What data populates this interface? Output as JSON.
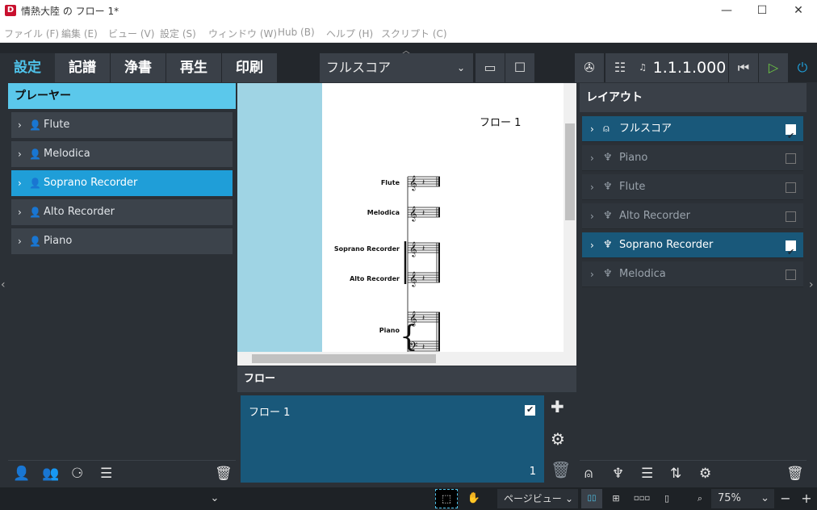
{
  "window": {
    "title": "情熱大陸 の フロー 1*",
    "app_icon": "D",
    "minimize": "—",
    "maximize": "☐",
    "close": "✕"
  },
  "menu": [
    "ファイル (F)",
    "編集 (E)",
    "ビュー (V)",
    "設定 (S)",
    "ウィンドウ (W)",
    "Hub (B)",
    "ヘルプ (H)",
    "スクリプト (C)"
  ],
  "modes": [
    "設定",
    "記譜",
    "浄書",
    "再生",
    "印刷"
  ],
  "active_mode": "設定",
  "toolbar": {
    "layout_select": "フルスコア",
    "position": "1.1.1.000"
  },
  "players_panel": {
    "title": "プレーヤー",
    "players": [
      {
        "name": "Flute",
        "selected": false
      },
      {
        "name": "Melodica",
        "selected": false
      },
      {
        "name": "Soprano Recorder",
        "selected": true
      },
      {
        "name": "Alto Recorder",
        "selected": false
      },
      {
        "name": "Piano",
        "selected": false
      }
    ]
  },
  "score": {
    "title": "フロー 1",
    "staves": [
      "Flute",
      "Melodica",
      "Soprano Recorder",
      "Alto Recorder",
      "Piano"
    ]
  },
  "flow_panel": {
    "title": "フロー",
    "flow_name": "フロー 1",
    "flow_number": "1",
    "checked": true
  },
  "layout_panel": {
    "title": "レイアウト",
    "items": [
      {
        "name": "フルスコア",
        "checked": true,
        "selected": true,
        "icon": "full-score-icon"
      },
      {
        "name": "Piano",
        "checked": false,
        "selected": false,
        "icon": "part-icon"
      },
      {
        "name": "Flute",
        "checked": false,
        "selected": false,
        "icon": "part-icon"
      },
      {
        "name": "Alto Recorder",
        "checked": false,
        "selected": false,
        "icon": "part-icon"
      },
      {
        "name": "Soprano Recorder",
        "checked": true,
        "selected": true,
        "icon": "part-icon"
      },
      {
        "name": "Melodica",
        "checked": false,
        "selected": false,
        "icon": "part-icon"
      }
    ]
  },
  "statusbar": {
    "view_select": "ページビュー",
    "zoom": "75%",
    "zoom_minus": "−",
    "zoom_plus": "+"
  },
  "colors": {
    "accent": "#1f9ed8",
    "panel_head": "#5bc8eb",
    "selected_layout": "#19587a",
    "play": "#6cc644"
  }
}
